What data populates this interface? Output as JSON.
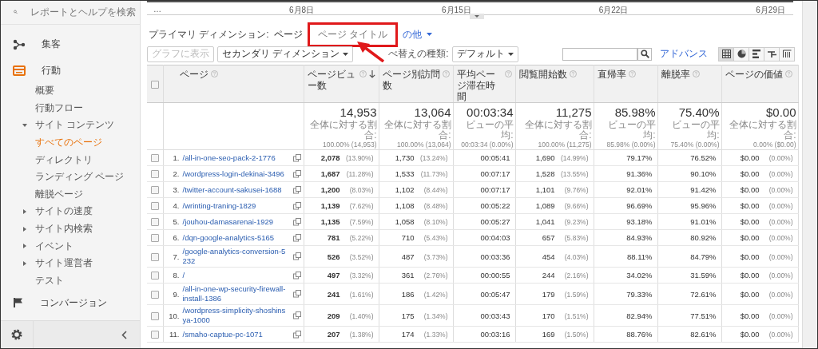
{
  "search": {
    "placeholder": "レポートとヘルプを検索"
  },
  "sidebar": {
    "items": [
      {
        "label": "集客",
        "kind": "audience",
        "selected": false
      },
      {
        "label": "行動",
        "kind": "behavior",
        "selected": true,
        "children": [
          {
            "label": "概要",
            "selected": false
          },
          {
            "label": "行動フロー",
            "selected": false
          },
          {
            "label": "サイト コンテンツ",
            "expanded": true,
            "selected": false,
            "children": [
              {
                "label": "すべてのページ",
                "selected": true
              },
              {
                "label": "ディレクトリ",
                "selected": false
              },
              {
                "label": "ランディング ページ",
                "selected": false
              },
              {
                "label": "離脱ページ",
                "selected": false
              }
            ]
          },
          {
            "label": "サイトの速度",
            "expanded": false,
            "selected": false
          },
          {
            "label": "サイト内検索",
            "expanded": false,
            "selected": false
          },
          {
            "label": "イベント",
            "expanded": false,
            "selected": false
          },
          {
            "label": "サイト運営者",
            "expanded": false,
            "selected": false
          },
          {
            "label": "テスト",
            "selected": false
          }
        ]
      },
      {
        "label": "コンバージョン",
        "kind": "conversion",
        "selected": false
      }
    ]
  },
  "chart": {
    "x_labels": [
      "…",
      "6月8日",
      "6月15日",
      "6月22日",
      "6月29日"
    ]
  },
  "primary_dimension": {
    "label": "プライマリ ディメンション:",
    "options": [
      {
        "label": "ページ",
        "kind": "option",
        "selected": true,
        "highlighted": false
      },
      {
        "label": "ページ タイトル",
        "kind": "option",
        "selected": false,
        "highlighted": true
      },
      {
        "label": "の他",
        "kind": "menu",
        "selected": false,
        "highlighted": false
      }
    ]
  },
  "toolbar": {
    "chart_button": {
      "label": "グラフに表示",
      "disabled": true
    },
    "secondary": {
      "label": "セカンダリ ディメンション"
    },
    "sort_label": "べ替えの種類:",
    "sort": {
      "value": "デフォルト"
    },
    "advanced": "アドバンス",
    "views": [
      {
        "kind": "table",
        "selected": true
      },
      {
        "kind": "pie",
        "selected": false
      },
      {
        "kind": "bar",
        "selected": false
      },
      {
        "kind": "compare",
        "selected": false
      },
      {
        "kind": "pivot",
        "selected": false
      }
    ]
  },
  "table": {
    "all_checked": false,
    "columns": [
      {
        "label": "ページ",
        "sorted": false
      },
      {
        "label": "ページビュー数",
        "sorted": true
      },
      {
        "label": "ページ別訪問数",
        "sorted": false
      },
      {
        "label": "平均ページ滞在時間",
        "sorted": false
      },
      {
        "label": "閲覧開始数",
        "sorted": false
      },
      {
        "label": "直帰率",
        "sorted": false
      },
      {
        "label": "離脱率",
        "sorted": false
      },
      {
        "label": "ページの価値",
        "sorted": false
      }
    ],
    "totals": [
      {
        "value": "14,953",
        "caption": "全体に対する割合:",
        "detail": "100.00% (14,953)"
      },
      {
        "value": "13,064",
        "caption": "全体に対する割合:",
        "detail": "100.00% (13,064)"
      },
      {
        "value": "00:03:34",
        "caption": "ビューの平均:",
        "detail": "00:03:34 (0.00%)"
      },
      {
        "value": "11,275",
        "caption": "全体に対する割合:",
        "detail": "100.00% (11,275)"
      },
      {
        "value": "85.98%",
        "caption": "ビューの平均:",
        "detail": "85.98% (0.00%)"
      },
      {
        "value": "75.40%",
        "caption": "ビューの平均:",
        "detail": "75.40% (0.00%)"
      },
      {
        "value": "$0.00",
        "caption": "全体に対する割合:",
        "detail": "0.00% ($0.00)"
      }
    ],
    "rows": [
      {
        "checked": false,
        "n": "1.",
        "page": "/all-in-one-seo-pack-2-1776",
        "pv": "2,078",
        "pv_pct": "(13.90%)",
        "visits": "1,730",
        "visits_pct": "(13.24%)",
        "avg": "00:05:41",
        "entr": "1,690",
        "entr_pct": "(14.99%)",
        "bounce": "79.17%",
        "exit": "76.52%",
        "value": "$0.00",
        "value_pct": "(0.00%)"
      },
      {
        "checked": false,
        "n": "2.",
        "page": "/wordpress-login-dekinai-3496",
        "pv": "1,687",
        "pv_pct": "(11.28%)",
        "visits": "1,533",
        "visits_pct": "(11.73%)",
        "avg": "00:07:17",
        "entr": "1,528",
        "entr_pct": "(13.55%)",
        "bounce": "91.36%",
        "exit": "90.10%",
        "value": "$0.00",
        "value_pct": "(0.00%)"
      },
      {
        "checked": false,
        "n": "3.",
        "page": "/twitter-account-sakusei-1688",
        "pv": "1,200",
        "pv_pct": "(8.03%)",
        "visits": "1,102",
        "visits_pct": "(8.44%)",
        "avg": "00:07:17",
        "entr": "1,101",
        "entr_pct": "(9.76%)",
        "bounce": "92.01%",
        "exit": "91.42%",
        "value": "$0.00",
        "value_pct": "(0.00%)"
      },
      {
        "checked": false,
        "n": "4.",
        "page": "/wrinting-traning-1829",
        "pv": "1,139",
        "pv_pct": "(7.62%)",
        "visits": "1,108",
        "visits_pct": "(8.48%)",
        "avg": "00:05:22",
        "entr": "1,089",
        "entr_pct": "(9.66%)",
        "bounce": "96.69%",
        "exit": "95.96%",
        "value": "$0.00",
        "value_pct": "(0.00%)"
      },
      {
        "checked": false,
        "n": "5.",
        "page": "/jouhou-damasarenai-1929",
        "pv": "1,135",
        "pv_pct": "(7.59%)",
        "visits": "1,058",
        "visits_pct": "(8.10%)",
        "avg": "00:05:27",
        "entr": "1,041",
        "entr_pct": "(9.23%)",
        "bounce": "93.18%",
        "exit": "91.01%",
        "value": "$0.00",
        "value_pct": "(0.00%)"
      },
      {
        "checked": false,
        "n": "6.",
        "page": "/dqn-google-analytics-5165",
        "pv": "781",
        "pv_pct": "(5.22%)",
        "visits": "710",
        "visits_pct": "(5.43%)",
        "avg": "00:04:03",
        "entr": "657",
        "entr_pct": "(5.83%)",
        "bounce": "84.93%",
        "exit": "80.92%",
        "value": "$0.00",
        "value_pct": "(0.00%)"
      },
      {
        "checked": false,
        "n": "7.",
        "page": "/google-analytics-conversion-5232",
        "pv": "526",
        "pv_pct": "(3.52%)",
        "visits": "487",
        "visits_pct": "(3.73%)",
        "avg": "00:03:36",
        "entr": "454",
        "entr_pct": "(4.03%)",
        "bounce": "88.11%",
        "exit": "84.79%",
        "value": "$0.00",
        "value_pct": "(0.00%)"
      },
      {
        "checked": false,
        "n": "8.",
        "page": "/",
        "pv": "497",
        "pv_pct": "(3.32%)",
        "visits": "361",
        "visits_pct": "(2.76%)",
        "avg": "00:00:55",
        "entr": "244",
        "entr_pct": "(2.16%)",
        "bounce": "34.02%",
        "exit": "31.59%",
        "value": "$0.00",
        "value_pct": "(0.00%)"
      },
      {
        "checked": false,
        "n": "9.",
        "page": "/all-in-one-wp-security-firewall-install-1386",
        "pv": "241",
        "pv_pct": "(1.61%)",
        "visits": "186",
        "visits_pct": "(1.42%)",
        "avg": "00:05:47",
        "entr": "179",
        "entr_pct": "(1.59%)",
        "bounce": "79.33%",
        "exit": "72.61%",
        "value": "$0.00",
        "value_pct": "(0.00%)"
      },
      {
        "checked": false,
        "n": "10.",
        "page": "/wordpress-simplicity-shoshinsya-1000",
        "pv": "209",
        "pv_pct": "(1.40%)",
        "visits": "175",
        "visits_pct": "(1.34%)",
        "avg": "00:03:43",
        "entr": "170",
        "entr_pct": "(1.51%)",
        "bounce": "82.94%",
        "exit": "77.51%",
        "value": "$0.00",
        "value_pct": "(0.00%)"
      },
      {
        "checked": false,
        "n": "11.",
        "page": "/smaho-captue-pc-1071",
        "pv": "207",
        "pv_pct": "(1.38%)",
        "visits": "174",
        "visits_pct": "(1.33%)",
        "avg": "00:03:16",
        "entr": "169",
        "entr_pct": "(1.50%)",
        "bounce": "88.76%",
        "exit": "82.61%",
        "value": "$0.00",
        "value_pct": "(0.00%)"
      }
    ]
  }
}
